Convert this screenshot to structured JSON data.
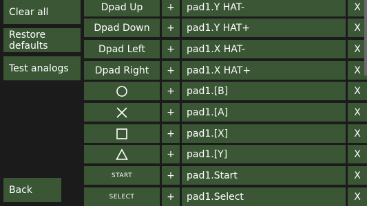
{
  "sidebar": {
    "clear_all": "Clear all",
    "restore_defaults": "Restore defaults",
    "test_analogs": "Test analogs",
    "back": "Back"
  },
  "mappings": [
    {
      "control": "Dpad Up",
      "plus": "+",
      "binding": "pad1.Y HAT-",
      "remove": "X"
    },
    {
      "control": "Dpad Down",
      "plus": "+",
      "binding": "pad1.Y HAT+",
      "remove": "X"
    },
    {
      "control": "Dpad Left",
      "plus": "+",
      "binding": "pad1.X HAT-",
      "remove": "X"
    },
    {
      "control": "Dpad Right",
      "plus": "+",
      "binding": "pad1.X HAT+",
      "remove": "X"
    },
    {
      "control_icon": "circle-icon",
      "plus": "+",
      "binding": "pad1.[B]",
      "remove": "X"
    },
    {
      "control_icon": "cross-icon",
      "plus": "+",
      "binding": "pad1.[A]",
      "remove": "X"
    },
    {
      "control_icon": "square-icon",
      "plus": "+",
      "binding": "pad1.[X]",
      "remove": "X"
    },
    {
      "control_icon": "triangle-icon",
      "plus": "+",
      "binding": "pad1.[Y]",
      "remove": "X"
    },
    {
      "control": "START",
      "plus": "+",
      "binding": "pad1.Start",
      "remove": "X"
    },
    {
      "control": "SELECT",
      "plus": "+",
      "binding": "pad1.Select",
      "remove": "X"
    }
  ],
  "colors": {
    "button_bg": "#3a5635",
    "background": "#1b1b1b",
    "text": "#ffffff"
  }
}
